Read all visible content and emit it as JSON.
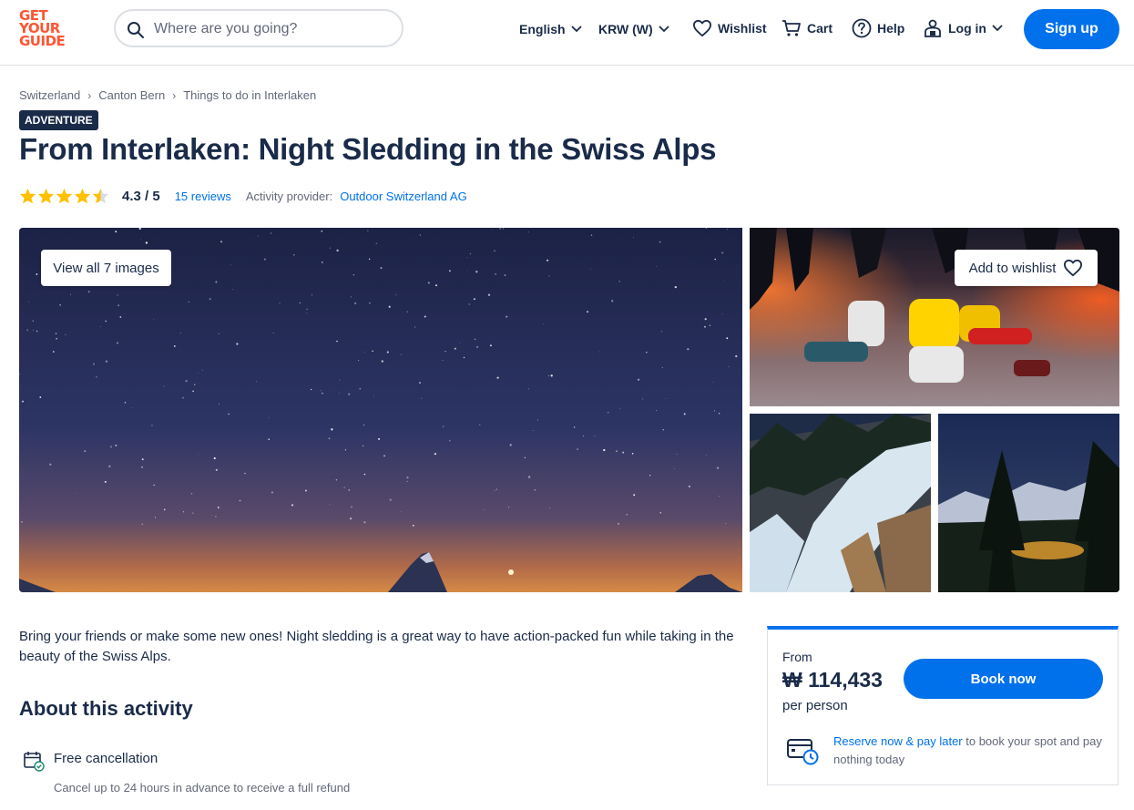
{
  "brand": {
    "logo_line1": "GET",
    "logo_line2": "YOUR",
    "logo_line3": "GUIDE",
    "accent": "#ff5533",
    "primary": "#0071eb",
    "text": "#1a2b49"
  },
  "search": {
    "placeholder": "Where are you going?"
  },
  "header": {
    "language": "English",
    "currency": "KRW (W)",
    "wishlist": "Wishlist",
    "cart": "Cart",
    "help": "Help",
    "login": "Log in",
    "signup": "Sign up"
  },
  "breadcrumb": [
    "Switzerland",
    "Canton Bern",
    "Things to do in Interlaken"
  ],
  "activity": {
    "category": "ADVENTURE",
    "title": "From Interlaken: Night Sledding in the Swiss Alps",
    "rating": "4.3 / 5",
    "rating_value": 4.3,
    "reviews": "15 reviews",
    "provider_label": "Activity provider:",
    "provider": "Outdoor Switzerland AG"
  },
  "gallery": {
    "view_all": "View all 7 images",
    "add_wishlist": "Add to wishlist"
  },
  "description": "Bring your friends or make some new ones! Night sledding is a great way to have action-packed fun while taking in the beauty of the Swiss Alps.",
  "about": {
    "heading": "About this activity",
    "items": [
      {
        "title": "Free cancellation",
        "subtitle": "Cancel up to 24 hours in advance to receive a full refund"
      }
    ]
  },
  "booking": {
    "from": "From",
    "price": "₩ 114,433",
    "per": "per person",
    "book_now": "Book now",
    "reserve_link": "Reserve now & pay later",
    "reserve_text": " to book your spot and pay nothing today"
  }
}
